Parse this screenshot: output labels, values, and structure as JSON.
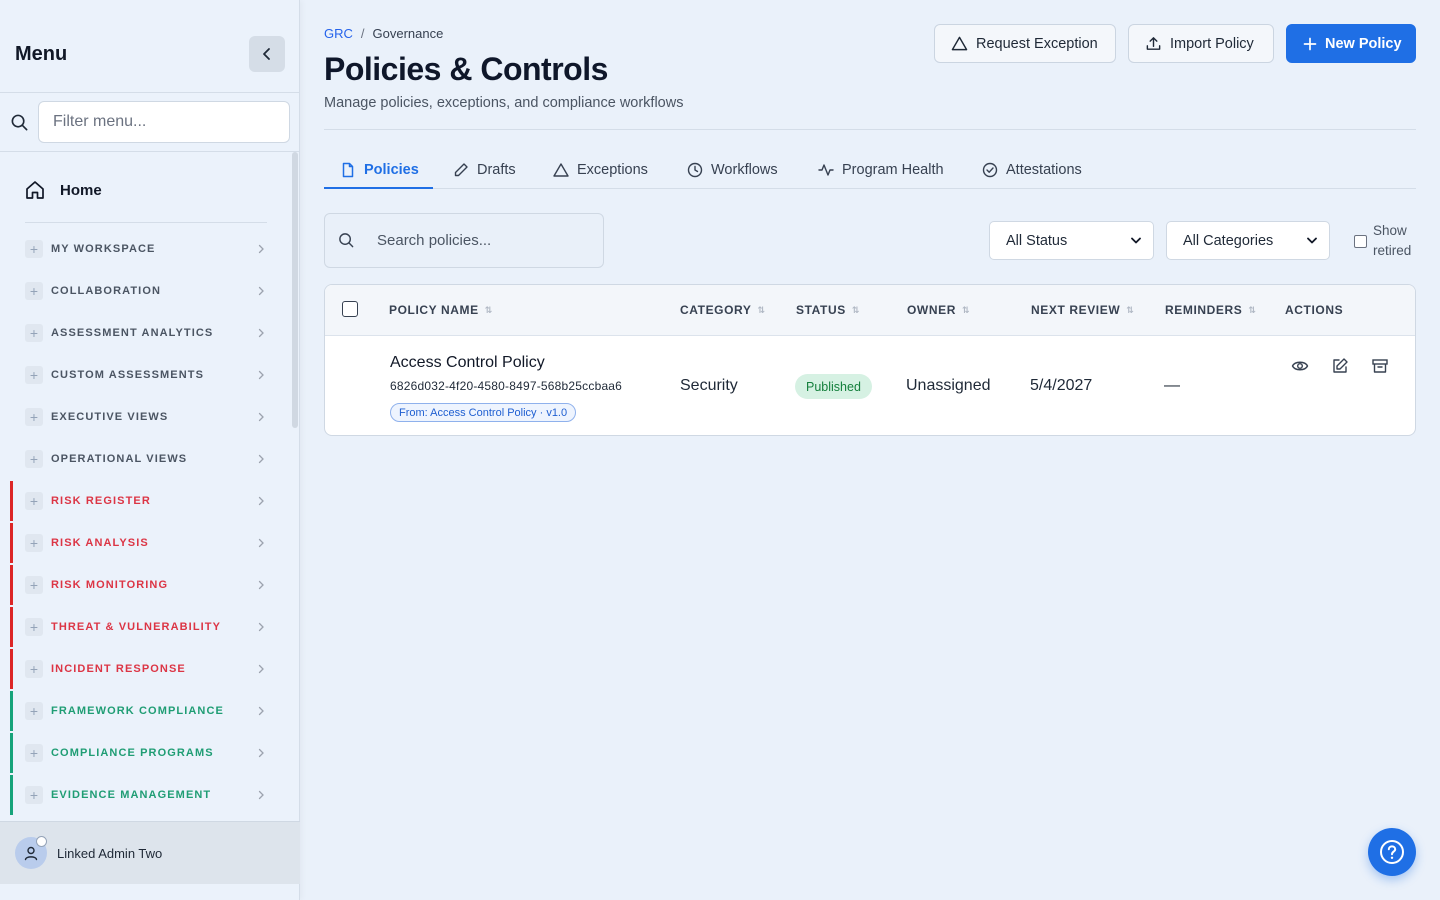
{
  "sidebar": {
    "title": "Menu",
    "filter_placeholder": "Filter menu...",
    "home_label": "Home",
    "items": [
      {
        "label": "MY WORKSPACE",
        "color": "#4b5563",
        "bar": ""
      },
      {
        "label": "COLLABORATION",
        "color": "#4b5563",
        "bar": ""
      },
      {
        "label": "ASSESSMENT ANALYTICS",
        "color": "#4b5563",
        "bar": ""
      },
      {
        "label": "CUSTOM ASSESSMENTS",
        "color": "#4b5563",
        "bar": ""
      },
      {
        "label": "EXECUTIVE VIEWS",
        "color": "#4b5563",
        "bar": ""
      },
      {
        "label": "OPERATIONAL VIEWS",
        "color": "#4b5563",
        "bar": ""
      },
      {
        "label": "RISK REGISTER",
        "color": "#dc3545",
        "bar": "#dc2626"
      },
      {
        "label": "RISK ANALYSIS",
        "color": "#dc3545",
        "bar": "#dc2626"
      },
      {
        "label": "RISK MONITORING",
        "color": "#dc3545",
        "bar": "#dc2626"
      },
      {
        "label": "THREAT & VULNERABILITY",
        "color": "#dc3545",
        "bar": "#dc2626"
      },
      {
        "label": "INCIDENT RESPONSE",
        "color": "#dc3545",
        "bar": "#dc2626"
      },
      {
        "label": "FRAMEWORK COMPLIANCE",
        "color": "#1f9d74",
        "bar": "#16a37a"
      },
      {
        "label": "COMPLIANCE PROGRAMS",
        "color": "#1f9d74",
        "bar": "#16a37a"
      },
      {
        "label": "EVIDENCE MANAGEMENT",
        "color": "#1f9d74",
        "bar": "#16a37a"
      }
    ],
    "user_name": "Linked Admin Two"
  },
  "header": {
    "breadcrumb_root": "GRC",
    "breadcrumb_separator": "/",
    "breadcrumb_current": "Governance",
    "title": "Policies & Controls",
    "subtitle": "Manage policies, exceptions, and compliance workflows",
    "request_exception_label": "Request Exception",
    "import_policy_label": "Import Policy",
    "new_policy_label": "New Policy"
  },
  "tabs": [
    {
      "label": "Policies",
      "icon": "document-icon",
      "active": true
    },
    {
      "label": "Drafts",
      "icon": "pencil-icon",
      "active": false
    },
    {
      "label": "Exceptions",
      "icon": "warning-triangle-icon",
      "active": false
    },
    {
      "label": "Workflows",
      "icon": "clock-icon",
      "active": false
    },
    {
      "label": "Program Health",
      "icon": "activity-icon",
      "active": false
    },
    {
      "label": "Attestations",
      "icon": "check-circle-icon",
      "active": false
    }
  ],
  "filters": {
    "search_placeholder": "Search policies...",
    "status_value": "All Status",
    "category_value": "All Categories",
    "show_retired_label": "Show retired"
  },
  "table": {
    "columns": [
      "POLICY NAME",
      "CATEGORY",
      "STATUS",
      "OWNER",
      "NEXT REVIEW",
      "REMINDERS",
      "ACTIONS"
    ],
    "rows": [
      {
        "name": "Access Control Policy",
        "id": "6826d032-4f20-4580-8497-568b25ccbaa6",
        "from": "From: Access Control Policy · v1.0",
        "category": "Security",
        "status": "Published",
        "owner": "Unassigned",
        "next_review": "5/4/2027",
        "reminders": "—"
      }
    ]
  },
  "colors": {
    "accent": "#1f6fe5",
    "risk": "#dc2626",
    "compliance": "#16a37a",
    "published_bg": "#d6f1e3",
    "published_text": "#15803d"
  }
}
